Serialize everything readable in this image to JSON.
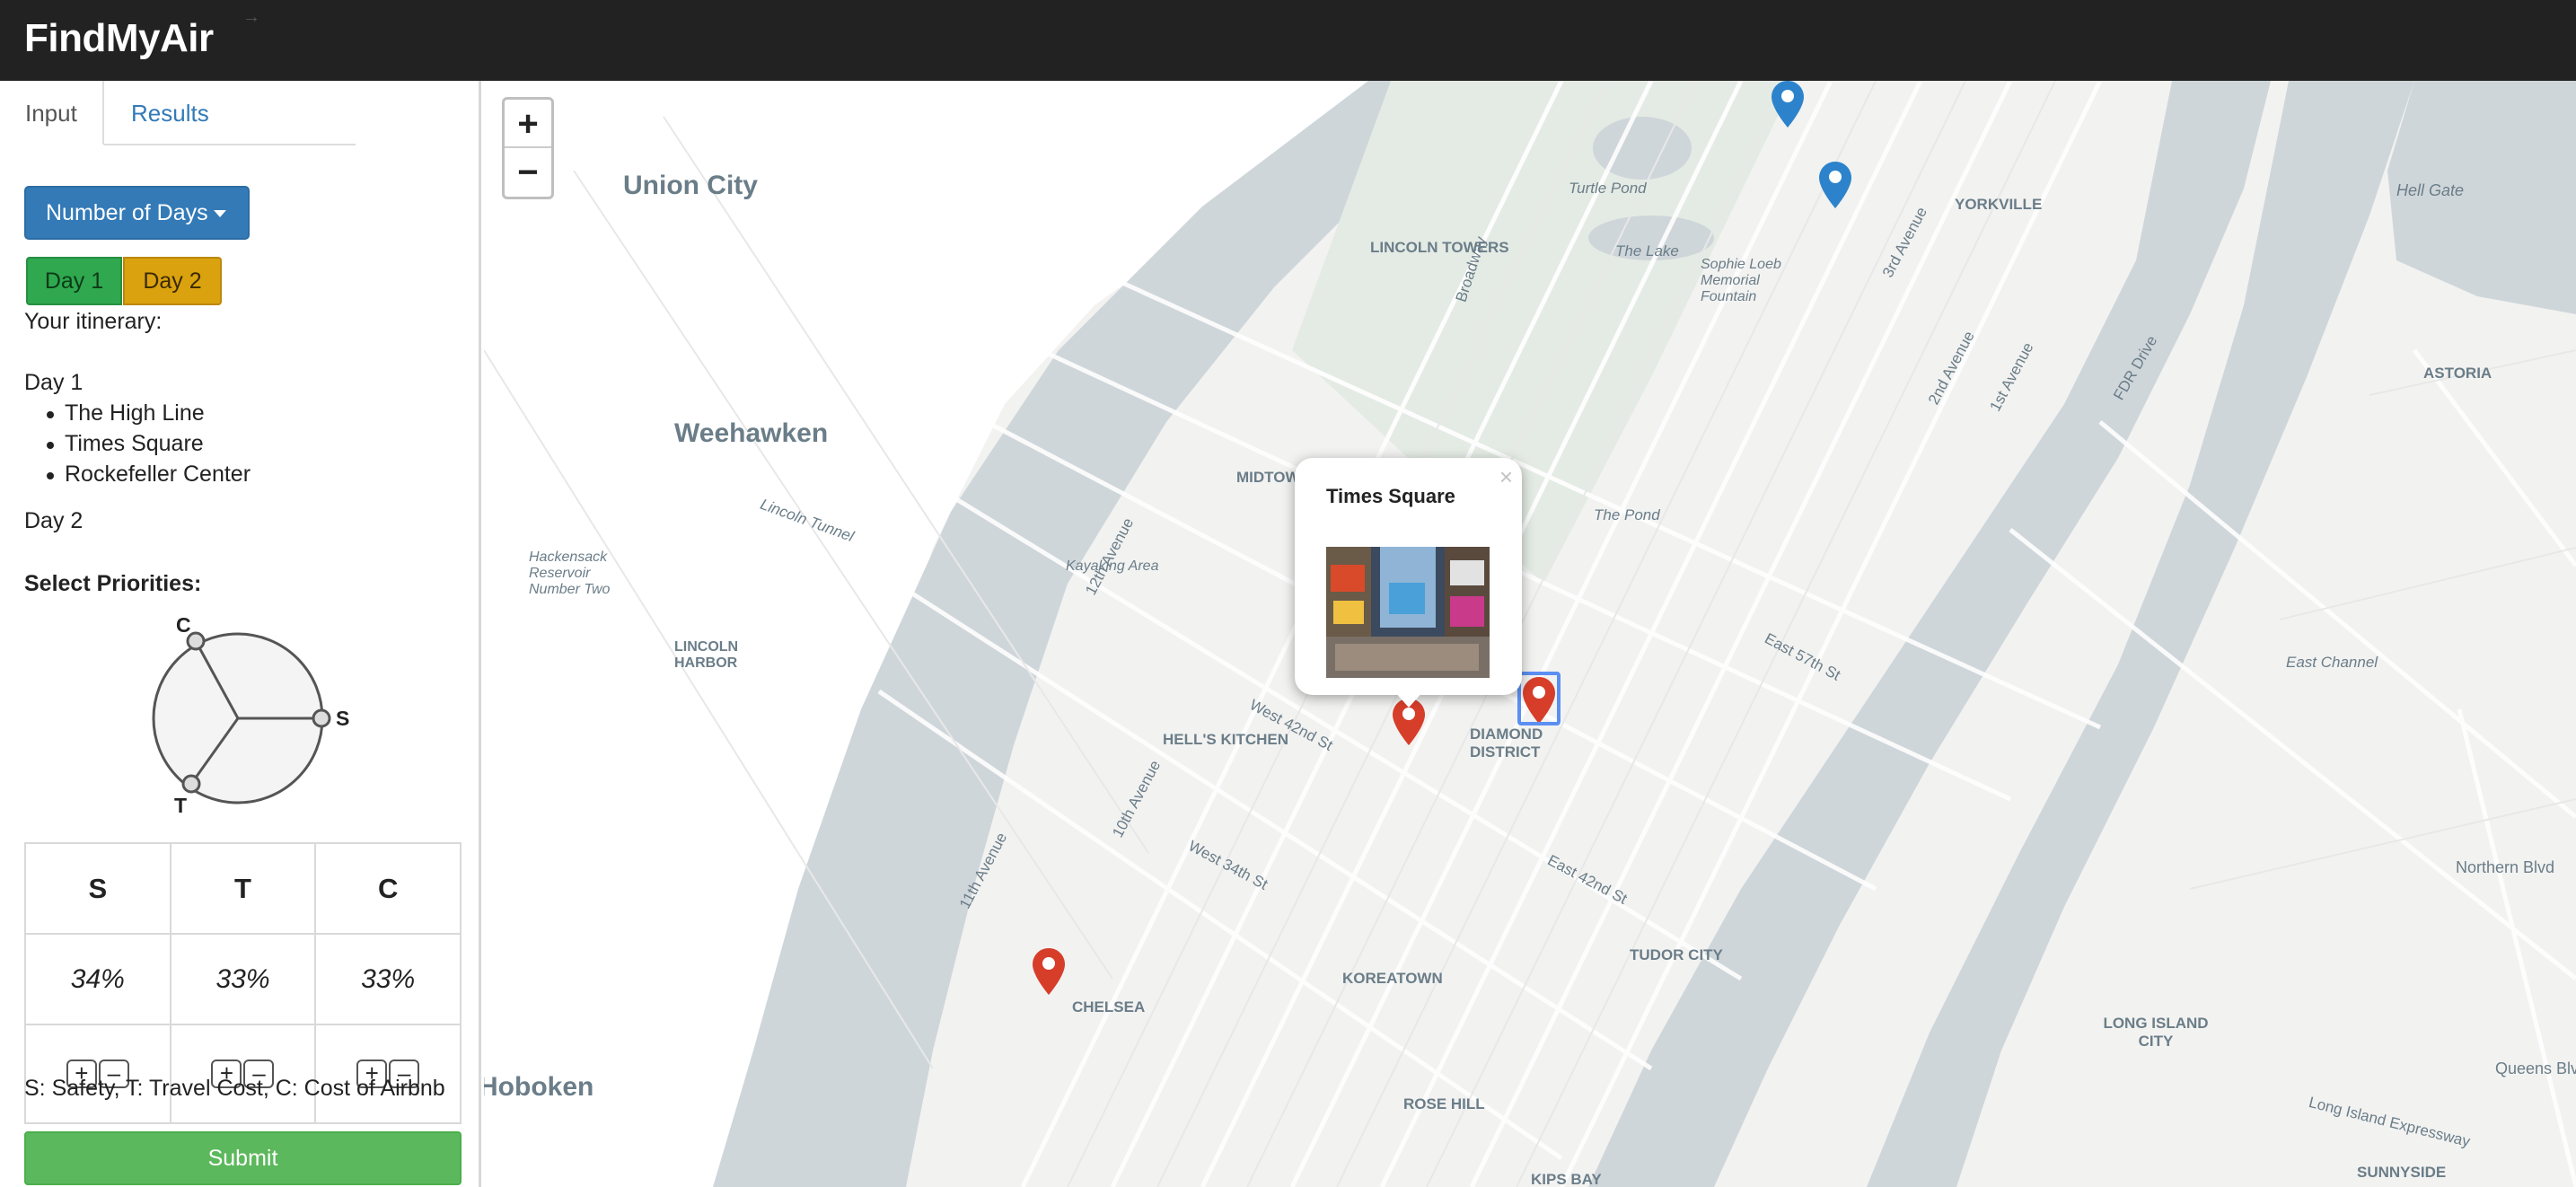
{
  "app": {
    "title": "FindMyAir"
  },
  "tabs": [
    {
      "label": "Input",
      "active": true
    },
    {
      "label": "Results",
      "active": false
    }
  ],
  "days_dropdown": {
    "label": "Number of Days"
  },
  "day_buttons": [
    {
      "label": "Day 1",
      "color": "#2fa84f"
    },
    {
      "label": "Day 2",
      "color": "#dba20f"
    }
  ],
  "itinerary": {
    "heading": "Your itinerary:",
    "days": [
      {
        "label": "Day 1",
        "items": [
          "The High Line",
          "Times Square",
          "Rockefeller Center"
        ]
      },
      {
        "label": "Day 2",
        "items": []
      }
    ]
  },
  "priorities": {
    "heading": "Select Priorities:",
    "chart_labels": {
      "c": "C",
      "s": "S",
      "t": "T"
    },
    "columns": [
      {
        "key": "S",
        "value": "34%"
      },
      {
        "key": "T",
        "value": "33%"
      },
      {
        "key": "C",
        "value": "33%"
      }
    ],
    "plus_label": "+",
    "minus_label": "–",
    "legend": "S: Safety, T: Travel Cost, C: Cost of Airbnb"
  },
  "submit_label": "Submit",
  "map": {
    "zoom_in": "+",
    "zoom_out": "−",
    "labels": [
      "Union City",
      "Weehawken",
      "Turtle Pond",
      "YORKVILLE",
      "Hell Gate",
      "ASTORIA",
      "LINCOLN TOWERS",
      "The Lake",
      "Sophie Loeb Memorial Fountain",
      "MIDTOWN",
      "The Pond",
      "Hackensack Reservoir Number Two",
      "LINCOLN HARBOR",
      "Kayaking Area",
      "HELL'S KITCHEN",
      "DIAMOND DISTRICT",
      "East Channel",
      "CHELSEA",
      "KOREATOWN",
      "TUDOR CITY",
      "LONG ISLAND CITY",
      "ROSE HILL",
      "Hoboken",
      "KIPS BAY",
      "SUNNYSIDE",
      "Northern Blvd",
      "Lincoln Tunnel",
      "East 57th St",
      "West 42nd St",
      "10th Avenue",
      "11th Avenue",
      "12th Avenue",
      "Broadway",
      "FDR Drive",
      "Long Island Expressway",
      "East 42nd St",
      "West 34th St",
      "3rd Avenue",
      "2nd Avenue",
      "1st Avenue",
      "Queens Blvd"
    ],
    "popup": {
      "title": "Times Square",
      "close": "×"
    },
    "markers": [
      {
        "color": "#2c83cb"
      },
      {
        "color": "#2c83cb"
      },
      {
        "color": "#d63e2a"
      },
      {
        "color": "#d63e2a"
      },
      {
        "color": "#d63e2a"
      }
    ]
  }
}
